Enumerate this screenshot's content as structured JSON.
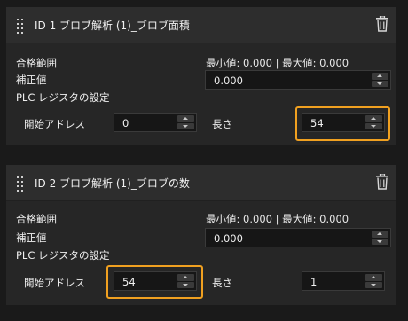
{
  "panels": [
    {
      "title": "ID 1 ブロブ解析 (1)_ブロブ面積",
      "range_label": "合格範囲",
      "range_value": "最小値: 0.000 | 最大値: 0.000",
      "offset_label": "補正値",
      "offset_value": "0.000",
      "plc_label": "PLC レジスタの設定",
      "start_label": "開始アドレス",
      "start_value": "0",
      "length_label": "長さ",
      "length_value": "54",
      "highlighted": "length"
    },
    {
      "title": "ID 2 ブロブ解析 (1)_ブロブの数",
      "range_label": "合格範囲",
      "range_value": "最小値: 0.000 | 最大値: 0.000",
      "offset_label": "補正値",
      "offset_value": "0.000",
      "plc_label": "PLC レジスタの設定",
      "start_label": "開始アドレス",
      "start_value": "54",
      "length_label": "長さ",
      "length_value": "1",
      "highlighted": "start"
    }
  ],
  "colors": {
    "highlight": "#f0a020",
    "panel": "#262626",
    "background": "#1a1a1a"
  },
  "icons": {
    "drag": "drag-handle-icon",
    "delete": "trash-icon"
  }
}
